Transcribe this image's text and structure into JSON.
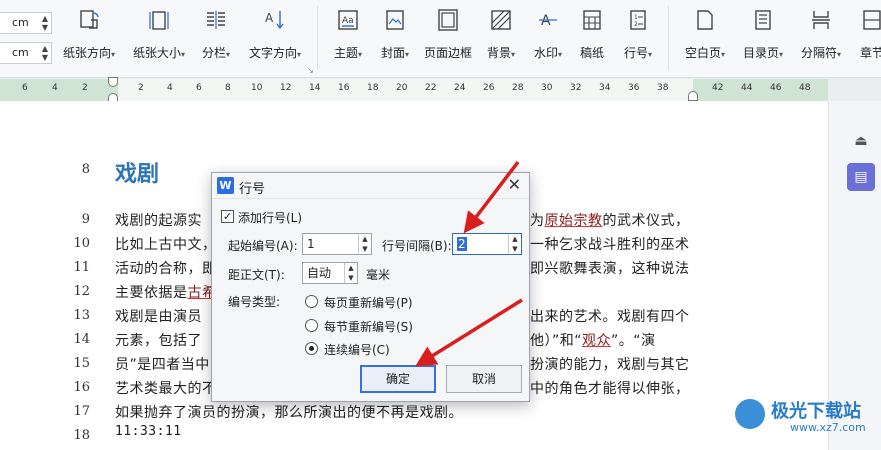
{
  "toolbar": {
    "unit_top": "cm",
    "unit_bottom": "cm",
    "items": [
      {
        "label": "纸张方向",
        "icon": "page-orientation-icon",
        "dropdown": true
      },
      {
        "label": "纸张大小",
        "icon": "page-size-icon",
        "dropdown": true
      },
      {
        "label": "分栏",
        "icon": "columns-icon",
        "dropdown": true
      },
      {
        "label": "文字方向",
        "icon": "text-direction-icon",
        "dropdown": true
      },
      {
        "label": "主题",
        "icon": "theme-icon",
        "dropdown": true
      },
      {
        "label": "封面",
        "icon": "cover-icon",
        "dropdown": true
      },
      {
        "label": "页面边框",
        "icon": "page-border-icon",
        "dropdown": false
      },
      {
        "label": "背景",
        "icon": "background-icon",
        "dropdown": true
      },
      {
        "label": "水印",
        "icon": "watermark-icon",
        "dropdown": true
      },
      {
        "label": "稿纸",
        "icon": "manuscript-icon",
        "dropdown": false
      },
      {
        "label": "行号",
        "icon": "line-number-icon",
        "dropdown": true
      },
      {
        "label": "空白页",
        "icon": "blank-page-icon",
        "dropdown": true
      },
      {
        "label": "目录页",
        "icon": "toc-page-icon",
        "dropdown": true
      },
      {
        "label": "分隔符",
        "icon": "separator-icon",
        "dropdown": true
      },
      {
        "label": "章节",
        "icon": "section-icon",
        "dropdown": true
      }
    ]
  },
  "ruler": {
    "left_numbers": [
      "6",
      "4",
      "2"
    ],
    "right_numbers": [
      "2",
      "4",
      "6",
      "8",
      "10",
      "12",
      "14",
      "16",
      "18",
      "20",
      "22",
      "24",
      "26",
      "28",
      "30",
      "32",
      "34",
      "36",
      "38"
    ],
    "far_numbers": [
      "42",
      "44",
      "46",
      "48"
    ]
  },
  "document": {
    "heading_line_number": "8",
    "heading": "戏剧",
    "lines": [
      {
        "n": "9",
        "pre": "戏剧的起源实",
        "post_a": "为",
        "red": "原始宗教",
        "post_b": "的武术仪式，"
      },
      {
        "n": "10",
        "pre": "比如上古中文，",
        "post_a": "一种乞求战斗胜利的巫术",
        "red": "",
        "post_b": ""
      },
      {
        "n": "11",
        "pre": "活动的合称，即",
        "post_a": "即兴歌舞表演，这种说法",
        "red": "",
        "post_b": ""
      },
      {
        "n": "12",
        "pre": "主要依据是",
        "red_pre": "古希",
        "post_a": "",
        "red": "",
        "post_b": ""
      },
      {
        "n": "13",
        "pre": "戏剧是由演员",
        "post_a": "出来的艺术。戏剧有四个",
        "red": "",
        "post_b": ""
      },
      {
        "n": "14",
        "pre": "元素，包括了",
        "post_a": "他）”和“",
        "red": "观众",
        "post_b": "”。“演"
      },
      {
        "n": "15",
        "pre": "员”是四者当中",
        "post_a": "扮演的能力，戏剧与其它",
        "red": "",
        "post_b": ""
      },
      {
        "n": "16",
        "pre": "艺术类最大的不",
        "post_a": "中的角色才能得以伸张，",
        "red": "",
        "post_b": ""
      },
      {
        "n": "17",
        "pre": "如果抛弃了演员的扮演，那么所演出的便不再是戏剧。",
        "post_a": "",
        "red": "",
        "post_b": ""
      },
      {
        "n": "18",
        "pre": "11:33:11",
        "post_a": "",
        "red": "",
        "post_b": ""
      }
    ]
  },
  "dialog": {
    "badge": "W",
    "title": "行号",
    "add_line_numbers_label": "添加行号(L)",
    "add_line_numbers_checked": true,
    "start_at_label": "起始编号(A):",
    "start_at_value": "1",
    "interval_label": "行号间隔(B):",
    "interval_value": "2",
    "from_text_label": "距正文(T):",
    "from_text_value": "自动",
    "from_text_unit": "毫米",
    "numbering_label": "编号类型:",
    "options": [
      {
        "label": "每页重新编号(P)",
        "selected": false
      },
      {
        "label": "每节重新编号(S)",
        "selected": false
      },
      {
        "label": "连续编号(C)",
        "selected": true
      }
    ],
    "ok_label": "确定",
    "cancel_label": "取消"
  },
  "watermark": {
    "title": "极光下载站",
    "url": "www.xz7.com"
  },
  "colors": {
    "heading": "#2e74b5",
    "ruler_green": "#cfe4d3",
    "annotation_arrow": "#d81e1e",
    "accent_blue": "#2f6fd6"
  }
}
